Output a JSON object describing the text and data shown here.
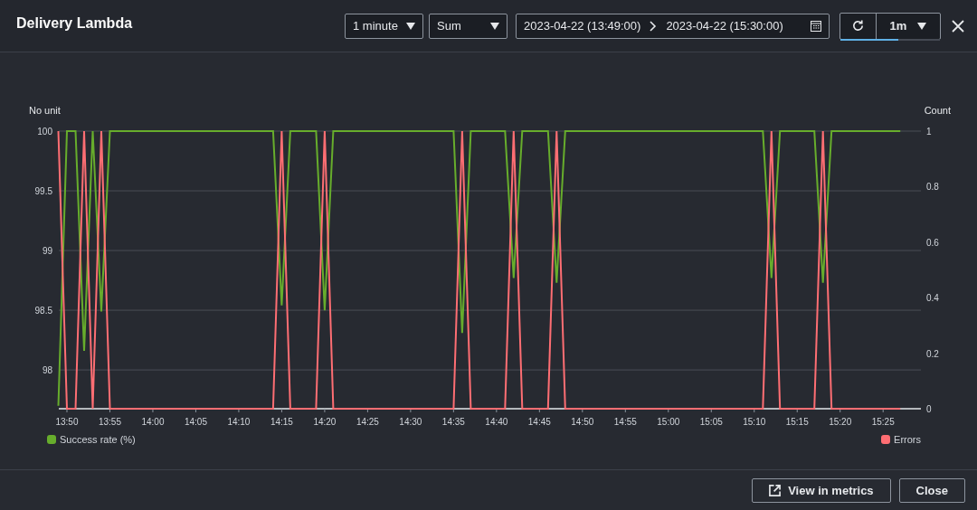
{
  "modal": {
    "title": "Delivery Lambda"
  },
  "controls": {
    "period": "1 minute",
    "statistic": "Sum",
    "range_start": "2023-04-22 (13:49:00)",
    "range_end": "2023-04-22 (15:30:00)",
    "refresh_interval": "1m",
    "refresh": {
      "level": 0.58
    }
  },
  "chart": {
    "chart_data": {
      "type": "line",
      "ylabel": "No unit",
      "y2label": "Count",
      "x": [
        829,
        830,
        831,
        832,
        833,
        834,
        835,
        836,
        837,
        838,
        839,
        840,
        841,
        842,
        843,
        844,
        845,
        846,
        847,
        848,
        849,
        850,
        851,
        852,
        853,
        854,
        855,
        856,
        857,
        858,
        859,
        860,
        861,
        862,
        863,
        864,
        865,
        866,
        867,
        868,
        869,
        870,
        871,
        872,
        873,
        874,
        875,
        876,
        877,
        878,
        879,
        880,
        881,
        882,
        883,
        884,
        885,
        886,
        887,
        888,
        889,
        890,
        891,
        892,
        893,
        894,
        895,
        896,
        897,
        898,
        899,
        900,
        901,
        902,
        903,
        904,
        905,
        906,
        907,
        908,
        909,
        910,
        911,
        912,
        913,
        914,
        915,
        916,
        917,
        918,
        919,
        920,
        921,
        922,
        923,
        924,
        925,
        926,
        927
      ],
      "xlim": [
        829,
        929.4
      ],
      "grid": true,
      "xticks": [
        {
          "value": 830,
          "label": "13:50"
        },
        {
          "value": 835,
          "label": "13:55"
        },
        {
          "value": 840,
          "label": "14:00"
        },
        {
          "value": 845,
          "label": "14:05"
        },
        {
          "value": 850,
          "label": "14:10"
        },
        {
          "value": 855,
          "label": "14:15"
        },
        {
          "value": 860,
          "label": "14:20"
        },
        {
          "value": 865,
          "label": "14:25"
        },
        {
          "value": 870,
          "label": "14:30"
        },
        {
          "value": 875,
          "label": "14:35"
        },
        {
          "value": 880,
          "label": "14:40"
        },
        {
          "value": 885,
          "label": "14:45"
        },
        {
          "value": 890,
          "label": "14:50"
        },
        {
          "value": 895,
          "label": "14:55"
        },
        {
          "value": 900,
          "label": "15:00"
        },
        {
          "value": 905,
          "label": "15:05"
        },
        {
          "value": 910,
          "label": "15:10"
        },
        {
          "value": 915,
          "label": "15:15"
        },
        {
          "value": 920,
          "label": "15:20"
        },
        {
          "value": 925,
          "label": "15:25"
        }
      ],
      "ylim": [
        97.675,
        100
      ],
      "yticks": [
        {
          "value": 100,
          "label": "100"
        },
        {
          "value": 99.5,
          "label": "99.5"
        },
        {
          "value": 99,
          "label": "99"
        },
        {
          "value": 98.5,
          "label": "98.5"
        },
        {
          "value": 98,
          "label": "98"
        }
      ],
      "y2lim": [
        0,
        1
      ],
      "y2ticks": [
        {
          "value": 1,
          "label": "1"
        },
        {
          "value": 0.8,
          "label": "0.8"
        },
        {
          "value": 0.6,
          "label": "0.6"
        },
        {
          "value": 0.4,
          "label": "0.4"
        },
        {
          "value": 0.2,
          "label": "0.2"
        },
        {
          "value": 0,
          "label": "0"
        }
      ],
      "series": [
        {
          "name": "Success rate (%)",
          "color": "#67ad2c",
          "values": [
            97.7,
            100,
            100,
            98.16,
            100,
            98.49,
            100,
            100,
            100,
            100,
            100,
            100,
            100,
            100,
            100,
            100,
            100,
            100,
            100,
            100,
            100,
            100,
            100,
            100,
            100,
            100,
            98.54,
            100,
            100,
            100,
            100,
            98.5,
            100,
            100,
            100,
            100,
            100,
            100,
            100,
            100,
            100,
            100,
            100,
            100,
            100,
            100,
            100,
            98.31,
            100,
            100,
            100,
            100,
            100,
            98.77,
            100,
            100,
            100,
            100,
            98.73,
            100,
            100,
            100,
            100,
            100,
            100,
            100,
            100,
            100,
            100,
            100,
            100,
            100,
            100,
            100,
            100,
            100,
            100,
            100,
            100,
            100,
            100,
            100,
            100,
            98.77,
            100,
            100,
            100,
            100,
            100,
            98.73,
            100,
            100,
            100,
            100,
            100,
            100,
            100,
            100,
            100
          ]
        },
        {
          "name": "Errors",
          "color": "#fe6e73",
          "axis": "y2",
          "values": [
            1,
            0,
            0,
            1,
            0,
            1,
            0,
            0,
            0,
            0,
            0,
            0,
            0,
            0,
            0,
            0,
            0,
            0,
            0,
            0,
            0,
            0,
            0,
            0,
            0,
            0,
            1,
            0,
            0,
            0,
            0,
            1,
            0,
            0,
            0,
            0,
            0,
            0,
            0,
            0,
            0,
            0,
            0,
            0,
            0,
            0,
            0,
            1,
            0,
            0,
            0,
            0,
            0,
            1,
            0,
            0,
            0,
            0,
            1,
            0,
            0,
            0,
            0,
            0,
            0,
            0,
            0,
            0,
            0,
            0,
            0,
            0,
            0,
            0,
            0,
            0,
            0,
            0,
            0,
            0,
            0,
            0,
            0,
            1,
            0,
            0,
            0,
            0,
            0,
            1,
            0,
            0,
            0,
            0,
            0,
            0,
            0,
            0,
            0
          ]
        }
      ]
    }
  },
  "footer": {
    "buttons": [
      {
        "label": "View in metrics",
        "kind": "external"
      },
      {
        "label": "Close",
        "kind": "plain"
      }
    ]
  }
}
